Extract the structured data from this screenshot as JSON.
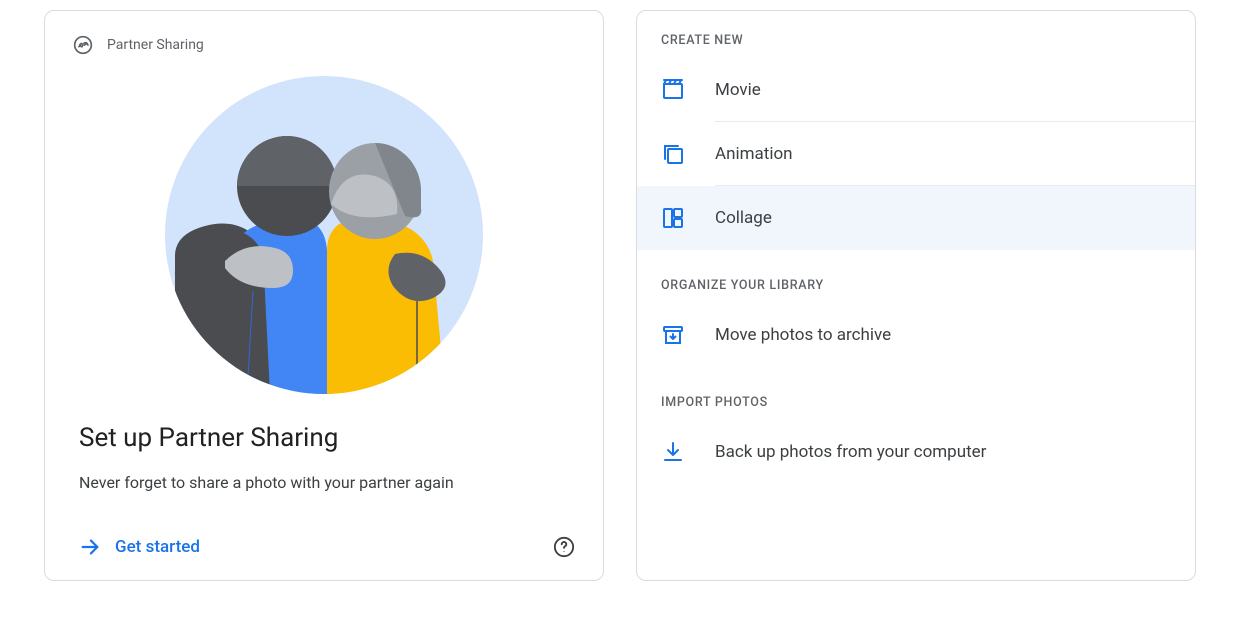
{
  "partnerCard": {
    "headerLabel": "Partner Sharing",
    "title": "Set up Partner Sharing",
    "subtitle": "Never forget to share a photo with your partner again",
    "ctaLabel": "Get started"
  },
  "sections": {
    "createNew": {
      "label": "CREATE NEW",
      "items": {
        "movie": "Movie",
        "animation": "Animation",
        "collage": "Collage"
      }
    },
    "organize": {
      "label": "ORGANIZE YOUR LIBRARY",
      "items": {
        "archive": "Move photos to archive"
      }
    },
    "import": {
      "label": "IMPORT PHOTOS",
      "items": {
        "backup": "Back up photos from your computer"
      }
    }
  }
}
